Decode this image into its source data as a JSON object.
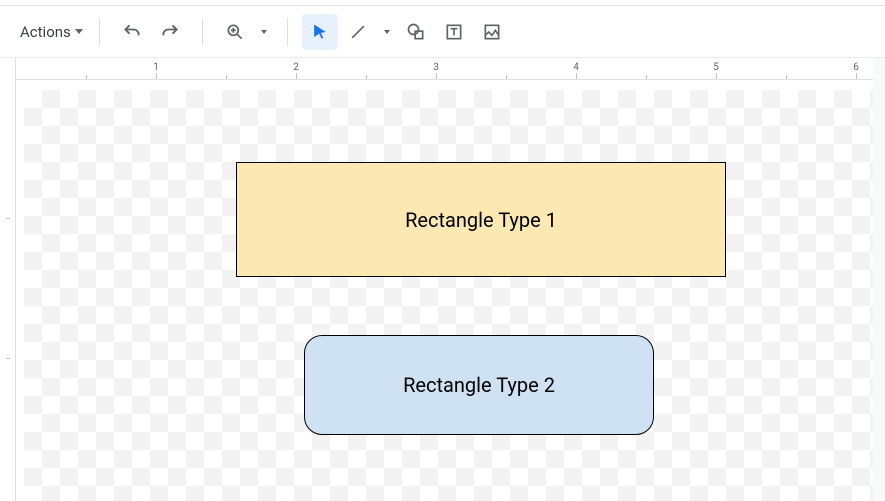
{
  "toolbar": {
    "actions_label": "Actions",
    "icons": {
      "undo": "undo-icon",
      "redo": "redo-icon",
      "zoom": "zoom-icon",
      "select": "select-icon",
      "line": "line-icon",
      "shape": "shape-icon",
      "text": "text-icon",
      "image": "image-icon"
    }
  },
  "ruler": {
    "labels": [
      "1",
      "2",
      "3",
      "4",
      "5",
      "6"
    ]
  },
  "shapes": {
    "rect1": {
      "label": "Rectangle Type 1"
    },
    "rect2": {
      "label": "Rectangle Type 2"
    }
  }
}
